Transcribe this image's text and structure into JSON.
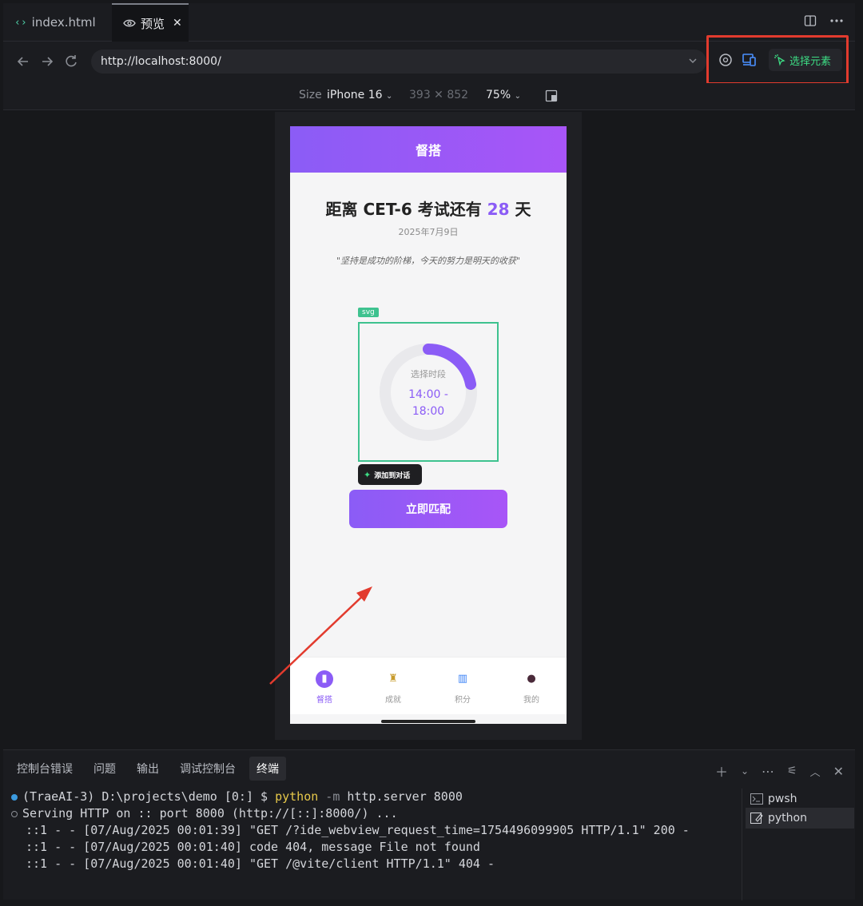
{
  "tabs": [
    {
      "label": "index.html"
    },
    {
      "label": "预览"
    }
  ],
  "address_bar": {
    "url": "http://localhost:8000/",
    "select_element_label": "选择元素"
  },
  "device_toolbar": {
    "size_label": "Size",
    "device": "iPhone 16",
    "dimensions": "393 ✕ 852",
    "zoom": "75%"
  },
  "app": {
    "header_title": "督搭",
    "headline_prefix": "距离 CET-6 考试还有 ",
    "headline_days": "28",
    "headline_suffix": " 天",
    "date": "2025年7月9日",
    "quote": "\"坚持是成功的阶梯，今天的努力是明天的收获\"",
    "svg_tag": "svg",
    "ring_label": "选择时段",
    "ring_time_line1": "14:00 -",
    "ring_time_line2": "18:00",
    "ring_progress": 0.22,
    "add_to_chat": "添加到对话",
    "match_button": "立即匹配",
    "nav": [
      {
        "label": "督搭",
        "icon": "book-icon"
      },
      {
        "label": "成就",
        "icon": "trophy-icon"
      },
      {
        "label": "积分",
        "icon": "chart-icon"
      },
      {
        "label": "我的",
        "icon": "user-icon"
      }
    ],
    "accent_color": "#8b5cf6"
  },
  "panel": {
    "tabs": [
      "控制台错误",
      "问题",
      "输出",
      "调试控制台",
      "终端"
    ],
    "active_tab": "终端",
    "terminal_lines": [
      {
        "prefix": "(TraeAI-3) D:\\projects\\demo [0:] $ ",
        "cmd": "python",
        "flag": " -m",
        "rest": " http.server 8000"
      },
      {
        "text": "Serving HTTP on :: port 8000 (http://[::]:8000/) ..."
      },
      {
        "text": "::1 - - [07/Aug/2025 00:01:39] \"GET /?ide_webview_request_time=1754496099905 HTTP/1.1\" 200 -"
      },
      {
        "text": "::1 - - [07/Aug/2025 00:01:40] code 404, message File not found"
      },
      {
        "text": "::1 - - [07/Aug/2025 00:01:40] \"GET /@vite/client HTTP/1.1\" 404 -"
      }
    ],
    "terminals": [
      {
        "label": "pwsh"
      },
      {
        "label": "python"
      }
    ]
  }
}
